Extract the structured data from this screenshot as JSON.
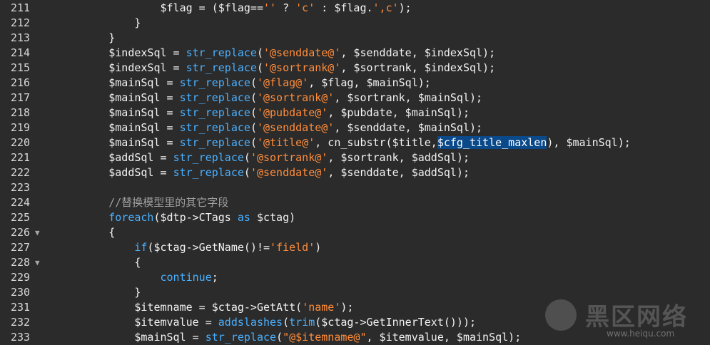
{
  "editor": {
    "lines": [
      {
        "num": "211",
        "fold": false,
        "tokens": [
          {
            "t": "var",
            "v": "                $flag = ($flag=="
          },
          {
            "t": "str",
            "v": "''"
          },
          {
            "t": "var",
            "v": " ? "
          },
          {
            "t": "str",
            "v": "'c'"
          },
          {
            "t": "var",
            "v": " : $flag."
          },
          {
            "t": "str",
            "v": "',c'"
          },
          {
            "t": "var",
            "v": ");"
          }
        ]
      },
      {
        "num": "212",
        "fold": false,
        "tokens": [
          {
            "t": "var",
            "v": "            }"
          }
        ]
      },
      {
        "num": "213",
        "fold": false,
        "tokens": [
          {
            "t": "var",
            "v": "        }"
          }
        ]
      },
      {
        "num": "214",
        "fold": false,
        "tokens": [
          {
            "t": "var",
            "v": "        $indexSql = "
          },
          {
            "t": "fn",
            "v": "str_replace"
          },
          {
            "t": "var",
            "v": "("
          },
          {
            "t": "str",
            "v": "'@senddate@'"
          },
          {
            "t": "var",
            "v": ", $senddate, $indexSql);"
          }
        ]
      },
      {
        "num": "215",
        "fold": false,
        "tokens": [
          {
            "t": "var",
            "v": "        $indexSql = "
          },
          {
            "t": "fn",
            "v": "str_replace"
          },
          {
            "t": "var",
            "v": "("
          },
          {
            "t": "str",
            "v": "'@sortrank@'"
          },
          {
            "t": "var",
            "v": ", $sortrank, $indexSql);"
          }
        ]
      },
      {
        "num": "216",
        "fold": false,
        "tokens": [
          {
            "t": "var",
            "v": "        $mainSql = "
          },
          {
            "t": "fn",
            "v": "str_replace"
          },
          {
            "t": "var",
            "v": "("
          },
          {
            "t": "str",
            "v": "'@flag@'"
          },
          {
            "t": "var",
            "v": ", $flag, $mainSql);"
          }
        ]
      },
      {
        "num": "217",
        "fold": false,
        "tokens": [
          {
            "t": "var",
            "v": "        $mainSql = "
          },
          {
            "t": "fn",
            "v": "str_replace"
          },
          {
            "t": "var",
            "v": "("
          },
          {
            "t": "str",
            "v": "'@sortrank@'"
          },
          {
            "t": "var",
            "v": ", $sortrank, $mainSql);"
          }
        ]
      },
      {
        "num": "218",
        "fold": false,
        "tokens": [
          {
            "t": "var",
            "v": "        $mainSql = "
          },
          {
            "t": "fn",
            "v": "str_replace"
          },
          {
            "t": "var",
            "v": "("
          },
          {
            "t": "str",
            "v": "'@pubdate@'"
          },
          {
            "t": "var",
            "v": ", $pubdate, $mainSql);"
          }
        ]
      },
      {
        "num": "219",
        "fold": false,
        "tokens": [
          {
            "t": "var",
            "v": "        $mainSql = "
          },
          {
            "t": "fn",
            "v": "str_replace"
          },
          {
            "t": "var",
            "v": "("
          },
          {
            "t": "str",
            "v": "'@senddate@'"
          },
          {
            "t": "var",
            "v": ", $senddate, $mainSql);"
          }
        ]
      },
      {
        "num": "220",
        "fold": false,
        "tokens": [
          {
            "t": "var",
            "v": "        $mainSql = "
          },
          {
            "t": "fn",
            "v": "str_replace"
          },
          {
            "t": "var",
            "v": "("
          },
          {
            "t": "str",
            "v": "'@title@'"
          },
          {
            "t": "var",
            "v": ", cn_substr($title,"
          },
          {
            "t": "sel",
            "v": "$cfg_title_maxlen"
          },
          {
            "t": "var",
            "v": "), $mainSql);"
          }
        ]
      },
      {
        "num": "221",
        "fold": false,
        "tokens": [
          {
            "t": "var",
            "v": "        $addSql = "
          },
          {
            "t": "fn",
            "v": "str_replace"
          },
          {
            "t": "var",
            "v": "("
          },
          {
            "t": "str",
            "v": "'@sortrank@'"
          },
          {
            "t": "var",
            "v": ", $sortrank, $addSql);"
          }
        ]
      },
      {
        "num": "222",
        "fold": false,
        "tokens": [
          {
            "t": "var",
            "v": "        $addSql = "
          },
          {
            "t": "fn",
            "v": "str_replace"
          },
          {
            "t": "var",
            "v": "("
          },
          {
            "t": "str",
            "v": "'@senddate@'"
          },
          {
            "t": "var",
            "v": ", $senddate, $addSql);"
          }
        ]
      },
      {
        "num": "223",
        "fold": false,
        "tokens": []
      },
      {
        "num": "224",
        "fold": false,
        "tokens": [
          {
            "t": "cm",
            "v": "        //替换模型里的其它字段"
          }
        ]
      },
      {
        "num": "225",
        "fold": false,
        "tokens": [
          {
            "t": "var",
            "v": "        "
          },
          {
            "t": "kw",
            "v": "foreach"
          },
          {
            "t": "var",
            "v": "($dtp->CTags "
          },
          {
            "t": "kw",
            "v": "as"
          },
          {
            "t": "var",
            "v": " $ctag)"
          }
        ]
      },
      {
        "num": "226",
        "fold": true,
        "tokens": [
          {
            "t": "var",
            "v": "        {"
          }
        ]
      },
      {
        "num": "227",
        "fold": false,
        "tokens": [
          {
            "t": "var",
            "v": "            "
          },
          {
            "t": "kw",
            "v": "if"
          },
          {
            "t": "var",
            "v": "($ctag->GetName()!="
          },
          {
            "t": "str",
            "v": "'field'"
          },
          {
            "t": "var",
            "v": ")"
          }
        ]
      },
      {
        "num": "228",
        "fold": true,
        "tokens": [
          {
            "t": "var",
            "v": "            {"
          }
        ]
      },
      {
        "num": "229",
        "fold": false,
        "tokens": [
          {
            "t": "var",
            "v": "                "
          },
          {
            "t": "kw",
            "v": "continue"
          },
          {
            "t": "var",
            "v": ";"
          }
        ]
      },
      {
        "num": "230",
        "fold": false,
        "tokens": [
          {
            "t": "var",
            "v": "            }"
          }
        ]
      },
      {
        "num": "231",
        "fold": false,
        "tokens": [
          {
            "t": "var",
            "v": "            $itemname = $ctag->GetAtt("
          },
          {
            "t": "str",
            "v": "'name'"
          },
          {
            "t": "var",
            "v": ");"
          }
        ]
      },
      {
        "num": "232",
        "fold": false,
        "tokens": [
          {
            "t": "var",
            "v": "            $itemvalue = "
          },
          {
            "t": "fn",
            "v": "addslashes"
          },
          {
            "t": "var",
            "v": "("
          },
          {
            "t": "fn",
            "v": "trim"
          },
          {
            "t": "var",
            "v": "($ctag->GetInnerText()));"
          }
        ]
      },
      {
        "num": "233",
        "fold": false,
        "tokens": [
          {
            "t": "var",
            "v": "            $mainSql = "
          },
          {
            "t": "fn",
            "v": "str_replace"
          },
          {
            "t": "var",
            "v": "("
          },
          {
            "t": "str",
            "v": "\"@$itemname@\""
          },
          {
            "t": "var",
            "v": ", $itemvalue, $mainSql);"
          }
        ]
      }
    ]
  },
  "watermark": {
    "title": "黑区网络",
    "url": "www.heiqu.com"
  }
}
